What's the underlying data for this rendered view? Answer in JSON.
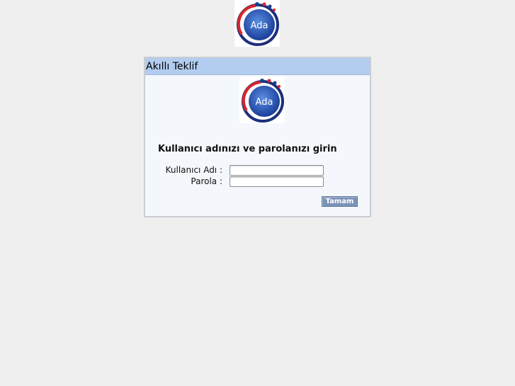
{
  "panel": {
    "title": "Akıllı Teklif",
    "logo_text": "Ada"
  },
  "top_logo": {
    "logo_text": "Ada"
  },
  "login": {
    "prompt": "Kullanıcı adınızı ve parolanızı girin",
    "username_label": "Kullanıcı Adı :",
    "username_value": "",
    "password_label": "Parola :",
    "password_value": "",
    "submit_label": "Tamam"
  },
  "colors": {
    "page_background": "#efefef",
    "header_background": "#b3cdf0",
    "panel_background": "#f4f8fc",
    "button_background": "#7b93b8",
    "logo_blue": "#1c3f8f",
    "logo_red": "#d8262c"
  }
}
